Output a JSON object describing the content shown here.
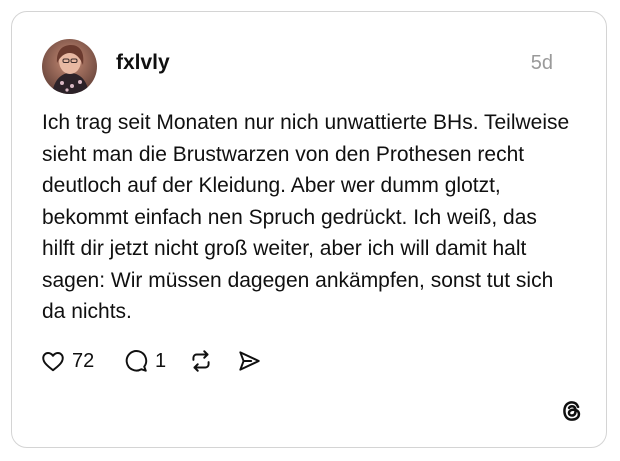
{
  "post": {
    "username": "fxlvly",
    "timestamp": "5d",
    "text": "Ich trag seit Monaten nur nich unwattierte BHs. Teilweise sieht man die Brustwarzen von den Prothesen recht deutloch auf der Kleidung. Aber wer dumm glotzt, bekommt einfach nen Spruch gedrückt. Ich weiß, das hilft dir jetzt nicht groß weiter, aber ich will damit halt sagen: Wir müssen dagegen ankämpfen, sonst tut sich da nichts.",
    "actions": {
      "likes": "72",
      "replies": "1"
    }
  },
  "icons": {
    "like": "heart-icon",
    "reply": "speech-bubble-icon",
    "repost": "repost-icon",
    "share": "send-icon",
    "brand": "threads-logo-icon"
  }
}
